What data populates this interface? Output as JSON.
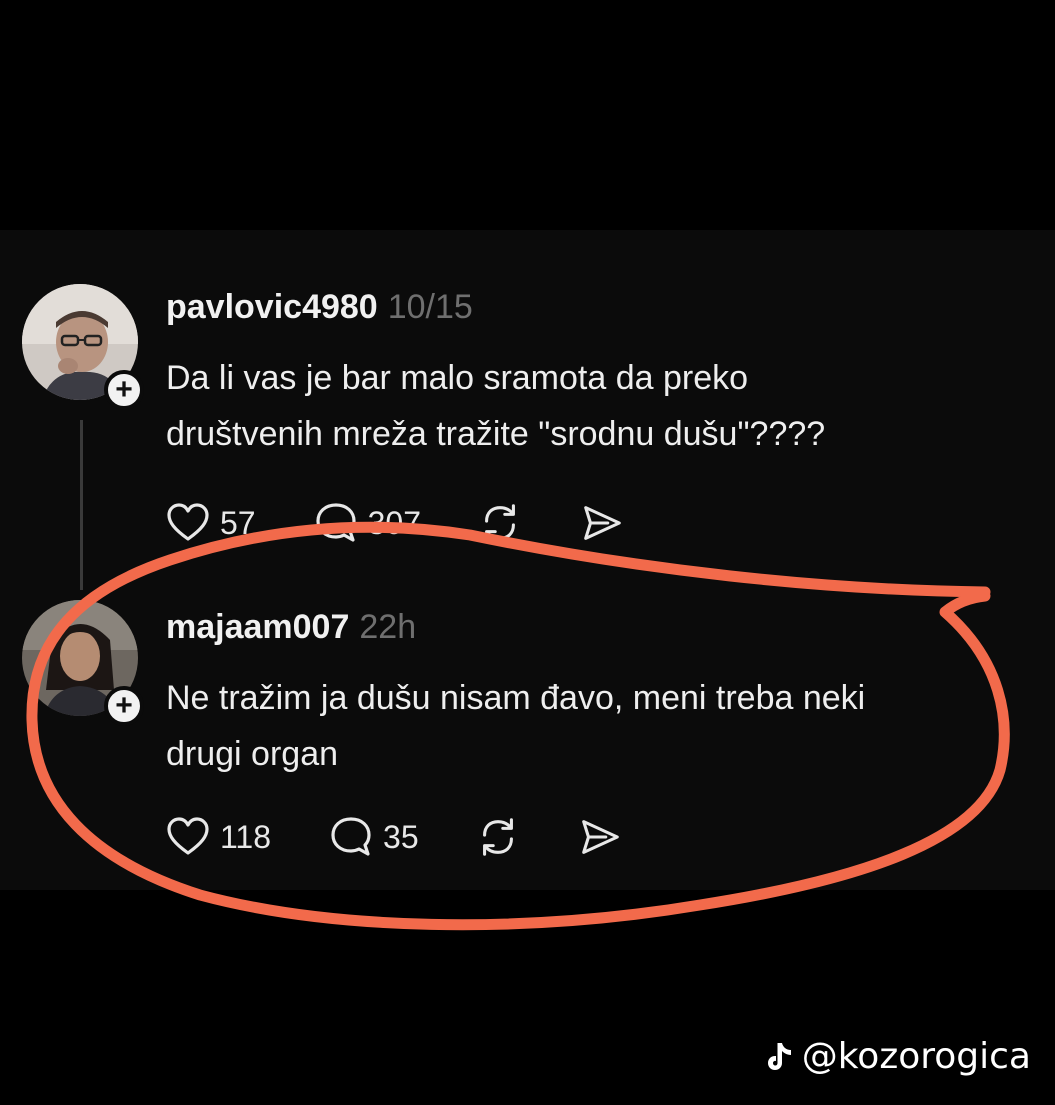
{
  "posts": [
    {
      "username": "pavlovic4980",
      "time": "10/15",
      "text": "Da li vas je bar malo sramota da preko\ndruštvenih mreža tražite \"srodnu dušu\"????",
      "likes": "57",
      "replies": "307",
      "follow_icon": "+"
    },
    {
      "username": "majaam007",
      "time": "22h",
      "text": "Ne tražim ja dušu nisam đavo, meni treba neki\ndrugi organ",
      "likes": "118",
      "replies": "35",
      "follow_icon": "+"
    }
  ],
  "icons": [
    "heart-icon",
    "comment-icon",
    "repost-icon",
    "share-icon",
    "tiktok-icon"
  ],
  "watermark": {
    "handle": "@kozorogica"
  },
  "colors": {
    "background": "#000000",
    "panel": "#0b0b0b",
    "timestamp": "#6f6f6f",
    "annotation": "#f26a4b"
  }
}
